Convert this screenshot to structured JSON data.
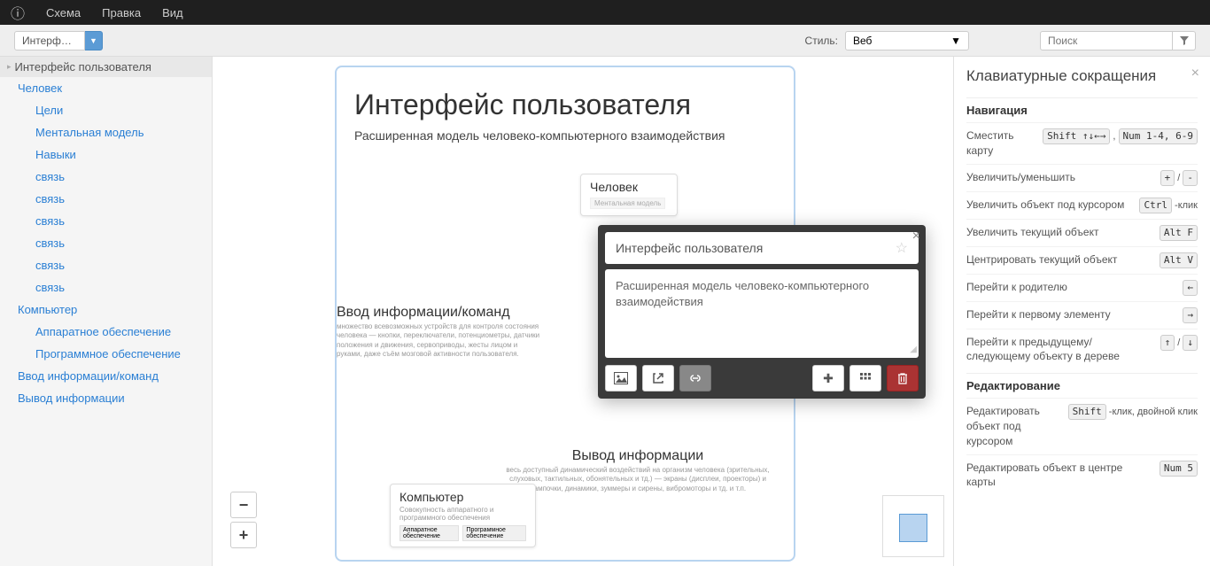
{
  "menu": {
    "info_icon": "ⓘ",
    "items": [
      "Схема",
      "Правка",
      "Вид"
    ]
  },
  "toolbar": {
    "selector": "Интерфейс...",
    "style_label": "Стиль:",
    "style_value": "Веб",
    "search_placeholder": "Поиск"
  },
  "sidebar": {
    "root": "Интерфейс пользователя",
    "items": [
      {
        "label": "Человек",
        "level": 1
      },
      {
        "label": "Цели",
        "level": 2
      },
      {
        "label": "Ментальная модель",
        "level": 2
      },
      {
        "label": "Навыки",
        "level": 2
      },
      {
        "label": "связь",
        "level": 2
      },
      {
        "label": "связь",
        "level": 2
      },
      {
        "label": "связь",
        "level": 2
      },
      {
        "label": "связь",
        "level": 2
      },
      {
        "label": "связь",
        "level": 2
      },
      {
        "label": "связь",
        "level": 2
      },
      {
        "label": "Компьютер",
        "level": 1
      },
      {
        "label": "Аппаратное обеспечение",
        "level": 2
      },
      {
        "label": "Программное обеспечение",
        "level": 2
      },
      {
        "label": "Ввод информации/команд",
        "level": 1
      },
      {
        "label": "Вывод информации",
        "level": 1
      }
    ]
  },
  "diagram": {
    "title": "Интерфейс пользователя",
    "subtitle": "Расширенная модель человеко-компьютерного взаимодействия",
    "human": {
      "title": "Человек",
      "sub": "Ментальная модель"
    },
    "input": {
      "title": "Ввод информации/команд",
      "desc": "множество всевозможных устройств для контроля состояния человека — кнопки, переключатели, потенциометры, датчики положения и движения, сервоприводы, жесты лицом и руками, даже съём мозговой активности пользователя."
    },
    "output": {
      "title": "Вывод информации",
      "desc": "весь доступный динамический воздействий на организм человека (зрительных, слуховых, тактильных, обонятельных и тд.) — экраны (дисплеи, проекторы) и лампочки, динамики, зуммеры и сирены, вибромоторы и тд. и т.п."
    },
    "computer": {
      "title": "Компьютер",
      "desc": "Совокупность аппаратного и программного обеспечения",
      "sub1": "Аппаратное обеспечение",
      "sub2": "Программное обеспечение"
    }
  },
  "popup": {
    "title": "Интерфейс пользователя",
    "body": "Расширенная модель человеко-компьютерного взаимодействия"
  },
  "zoom": {
    "in": "+",
    "out": "−"
  },
  "help": {
    "title": "Клавиатурные сокращения",
    "sections": [
      {
        "heading": "Навигация",
        "rows": [
          {
            "label": "Сместить карту",
            "keys": [
              [
                "Shift",
                "↑↓←→"
              ],
              ",",
              [
                "Num",
                "1-4, 6-9"
              ]
            ]
          },
          {
            "label": "Увеличить/уменьшить",
            "keys": [
              [
                "+"
              ],
              "/",
              [
                "-"
              ]
            ]
          },
          {
            "label": "Увеличить объект под курсором",
            "keys": [
              [
                "Ctrl"
              ],
              "-клик"
            ]
          },
          {
            "label": "Увеличить текущий объект",
            "keys": [
              [
                "Alt",
                "F"
              ]
            ]
          },
          {
            "label": "Центрировать текущий объект",
            "keys": [
              [
                "Alt",
                "V"
              ]
            ]
          },
          {
            "label": "Перейти к родителю",
            "keys": [
              [
                "←"
              ]
            ]
          },
          {
            "label": "Перейти к первому элементу",
            "keys": [
              [
                "→"
              ]
            ]
          },
          {
            "label": "Перейти к предыдущему/ следующему объекту в дереве",
            "keys": [
              [
                "↑"
              ],
              "/",
              [
                "↓"
              ]
            ]
          }
        ]
      },
      {
        "heading": "Редактирование",
        "rows": [
          {
            "label": "Редактировать объект под курсором",
            "keys": [
              [
                "Shift"
              ],
              "-клик,",
              "двойной клик"
            ]
          },
          {
            "label": "Редактировать объект в центре карты",
            "keys": [
              [
                "Num",
                "5"
              ]
            ]
          }
        ]
      }
    ]
  }
}
